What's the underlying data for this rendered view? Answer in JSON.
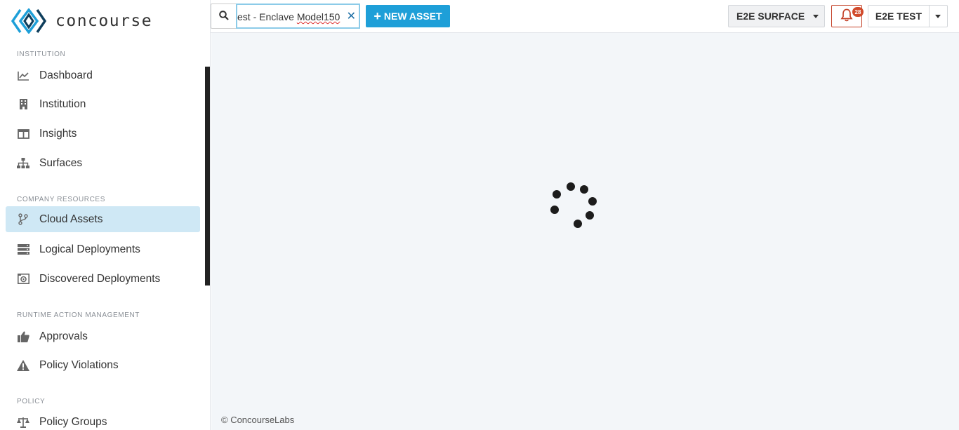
{
  "brand": {
    "name": "concourse"
  },
  "sidebar": {
    "sections": [
      {
        "label": "INSTITUTION",
        "items": [
          {
            "label": "Dashboard",
            "icon": "chart-line-icon"
          },
          {
            "label": "Institution",
            "icon": "building-icon"
          },
          {
            "label": "Insights",
            "icon": "columns-icon"
          },
          {
            "label": "Surfaces",
            "icon": "sitemap-icon"
          }
        ]
      },
      {
        "label": "COMPANY RESOURCES",
        "items": [
          {
            "label": "Cloud Assets",
            "icon": "branch-icon",
            "active": true
          },
          {
            "label": "Logical Deployments",
            "icon": "server-icon"
          },
          {
            "label": "Discovered Deployments",
            "icon": "radar-icon"
          }
        ]
      },
      {
        "label": "RUNTIME ACTION MANAGEMENT",
        "items": [
          {
            "label": "Approvals",
            "icon": "thumbs-up-icon"
          },
          {
            "label": "Policy Violations",
            "icon": "warning-icon"
          }
        ]
      },
      {
        "label": "POLICY",
        "items": [
          {
            "label": "Policy Groups",
            "icon": "balance-scale-icon"
          }
        ]
      }
    ]
  },
  "header": {
    "search": {
      "value": "est - Enclave Model150",
      "value_prefix": "est - Enclave ",
      "value_underlined": "Model150"
    },
    "new_asset_label": "NEW ASSET",
    "surface_select": "E2E SURFACE",
    "notifications_count": "28",
    "user_label": "E2E TEST"
  },
  "main": {
    "loading": true
  },
  "footer": {
    "text": "© ConcourseLabs"
  },
  "colors": {
    "accent": "#1e9fd8",
    "active_nav_bg": "#cfe8f5",
    "main_bg": "#f3f6f9",
    "notification": "#d14a2b"
  }
}
